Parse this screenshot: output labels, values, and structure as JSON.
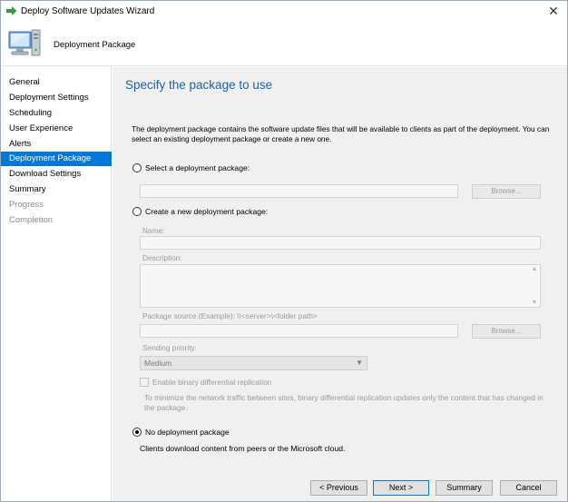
{
  "window": {
    "title": "Deploy Software Updates Wizard",
    "close_glyph": "✕"
  },
  "banner": {
    "heading": "Deployment Package"
  },
  "sidebar": {
    "items": [
      {
        "label": "General",
        "state": "normal"
      },
      {
        "label": "Deployment Settings",
        "state": "normal"
      },
      {
        "label": "Scheduling",
        "state": "normal"
      },
      {
        "label": "User Experience",
        "state": "normal"
      },
      {
        "label": "Alerts",
        "state": "normal"
      },
      {
        "label": "Deployment Package",
        "state": "active"
      },
      {
        "label": "Download Settings",
        "state": "normal"
      },
      {
        "label": "Summary",
        "state": "normal"
      },
      {
        "label": "Progress",
        "state": "disabled"
      },
      {
        "label": "Completion",
        "state": "disabled"
      }
    ]
  },
  "main": {
    "title": "Specify the package to use",
    "intro": "The deployment package contains the software update files that will be available to clients as part of the deployment. You can select an existing deployment package or create a new one.",
    "select_existing": {
      "label": "Select a deployment package:",
      "selected": false,
      "value": "",
      "browse_label": "Browse..."
    },
    "create_new": {
      "label": "Create a new deployment package:",
      "selected": false,
      "name_label": "Name:",
      "name_value": "",
      "description_label": "Description:",
      "description_value": "",
      "source_label": "Package source (Example): \\\\<server>\\<folder path>",
      "source_value": "",
      "browse_label": "Browse...",
      "priority_label": "Sending priority:",
      "priority_value": "Medium",
      "binary_diff_label": "Enable binary differential replication",
      "binary_diff_checked": false,
      "binary_diff_note": "To minimize the network traffic between sites, binary differential replication updates only the content that has changed in the package."
    },
    "no_package": {
      "label": "No deployment package",
      "selected": true,
      "note": "Clients download content from peers or the Microsoft cloud."
    }
  },
  "footer": {
    "previous_label": "< Previous",
    "next_label": "Next >",
    "summary_label": "Summary",
    "cancel_label": "Cancel"
  },
  "colors": {
    "accent": "#0078d7",
    "title_blue": "#1f5fa8",
    "arrow_green": "#2e9d3a"
  },
  "icons": {
    "app": "green-arrow-icon",
    "banner": "computer-icon"
  }
}
